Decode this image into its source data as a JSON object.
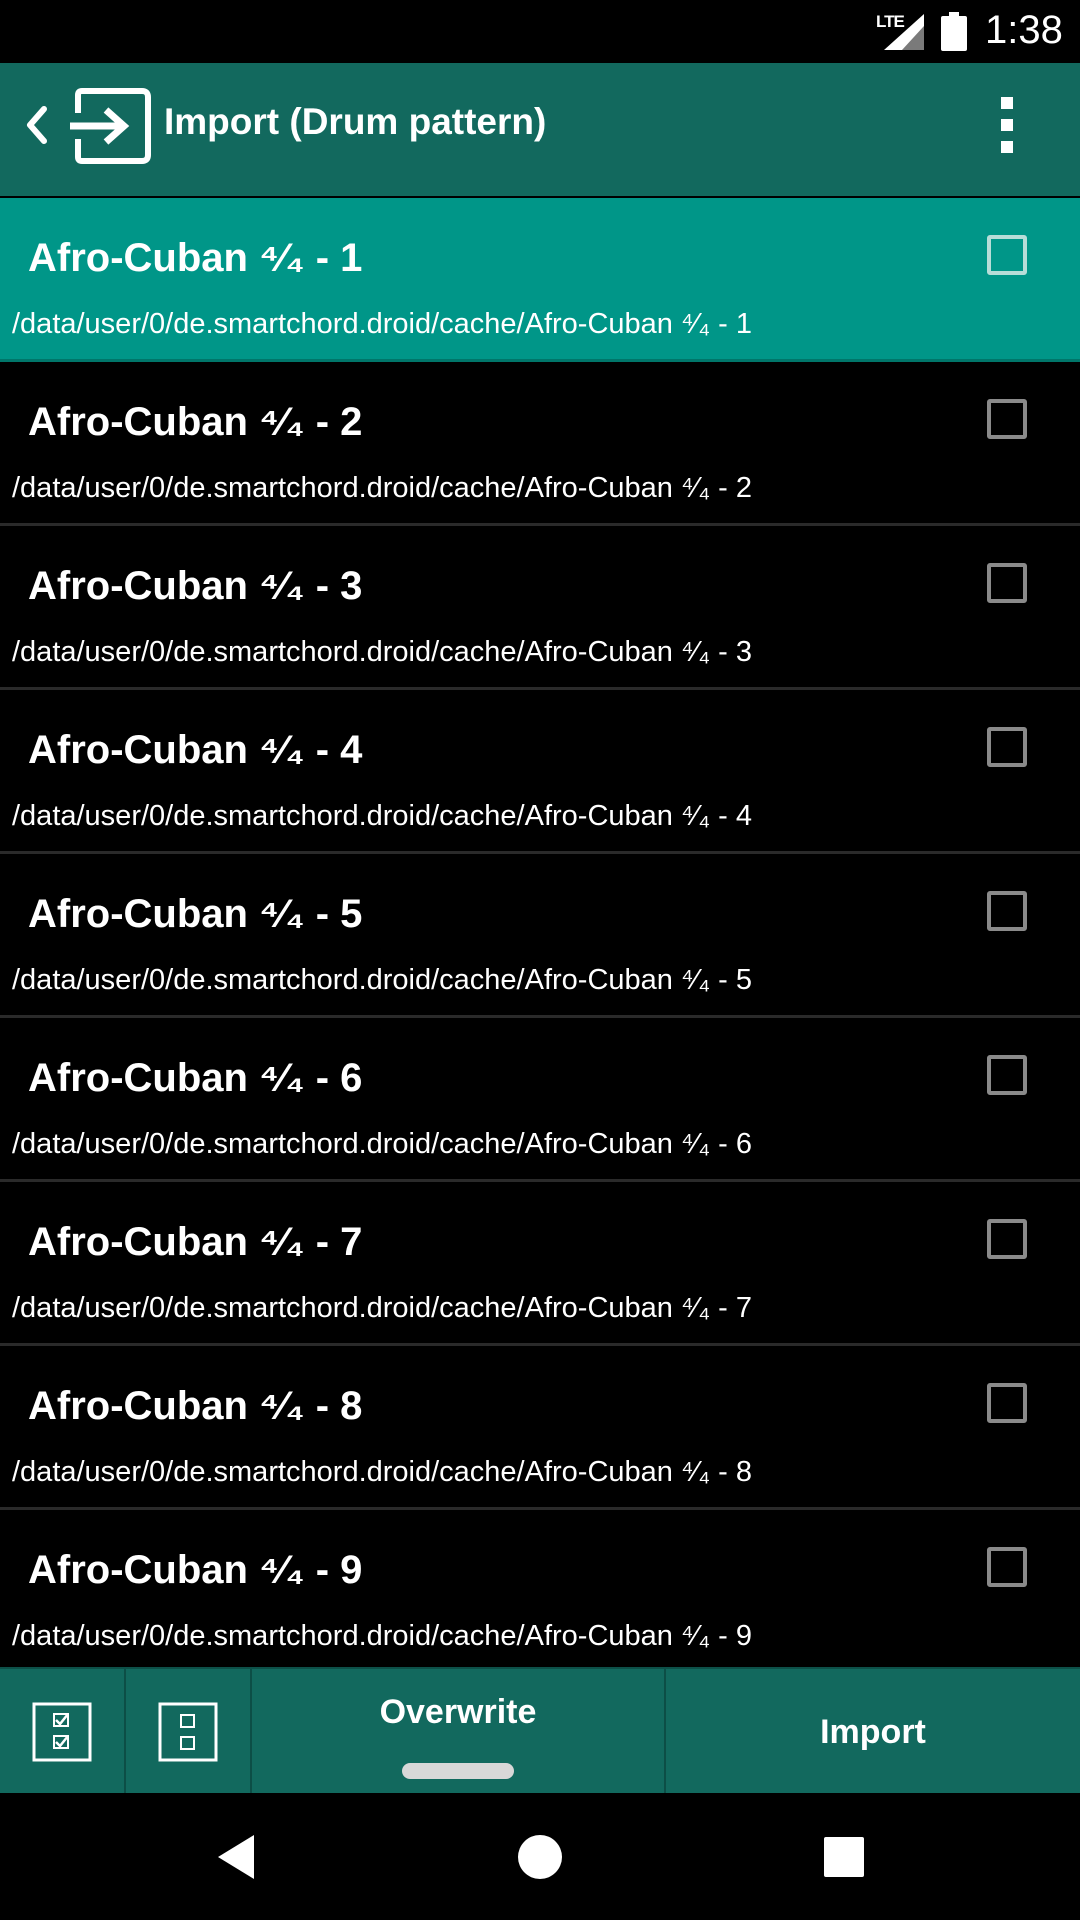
{
  "status_bar": {
    "network": "LTE",
    "time": "1:38"
  },
  "app_bar": {
    "title": "Import (Drum pattern)",
    "icons": [
      "chevron-left-icon",
      "import-icon",
      "overflow-menu-icon"
    ]
  },
  "items": [
    {
      "name": "Afro-Cuban ⁴⁄₄ - 1",
      "path": "/data/user/0/de.smartchord.droid/cache/Afro-Cuban ⁴⁄₄ - 1",
      "selected": true
    },
    {
      "name": "Afro-Cuban ⁴⁄₄ - 2",
      "path": "/data/user/0/de.smartchord.droid/cache/Afro-Cuban ⁴⁄₄ - 2",
      "selected": false
    },
    {
      "name": "Afro-Cuban ⁴⁄₄ - 3",
      "path": "/data/user/0/de.smartchord.droid/cache/Afro-Cuban ⁴⁄₄ - 3",
      "selected": false
    },
    {
      "name": "Afro-Cuban ⁴⁄₄ - 4",
      "path": "/data/user/0/de.smartchord.droid/cache/Afro-Cuban ⁴⁄₄ - 4",
      "selected": false
    },
    {
      "name": "Afro-Cuban ⁴⁄₄ - 5",
      "path": "/data/user/0/de.smartchord.droid/cache/Afro-Cuban ⁴⁄₄ - 5",
      "selected": false
    },
    {
      "name": "Afro-Cuban ⁴⁄₄ - 6",
      "path": "/data/user/0/de.smartchord.droid/cache/Afro-Cuban ⁴⁄₄ - 6",
      "selected": false
    },
    {
      "name": "Afro-Cuban ⁴⁄₄ - 7",
      "path": "/data/user/0/de.smartchord.droid/cache/Afro-Cuban ⁴⁄₄ - 7",
      "selected": false
    },
    {
      "name": "Afro-Cuban ⁴⁄₄ - 8",
      "path": "/data/user/0/de.smartchord.droid/cache/Afro-Cuban ⁴⁄₄ - 8",
      "selected": false
    },
    {
      "name": "Afro-Cuban ⁴⁄₄ - 9",
      "path": "/data/user/0/de.smartchord.droid/cache/Afro-Cuban ⁴⁄₄ - 9",
      "selected": false
    }
  ],
  "toolbar": {
    "overwrite_label": "Overwrite",
    "import_label": "Import",
    "icons": [
      "select-all-icon",
      "deselect-all-icon"
    ]
  },
  "nav_bar": {
    "icons": [
      "back-icon",
      "home-icon",
      "recents-icon"
    ]
  },
  "colors": {
    "app_bar": "#12695e",
    "selected_row": "#009688",
    "background": "#000000"
  }
}
